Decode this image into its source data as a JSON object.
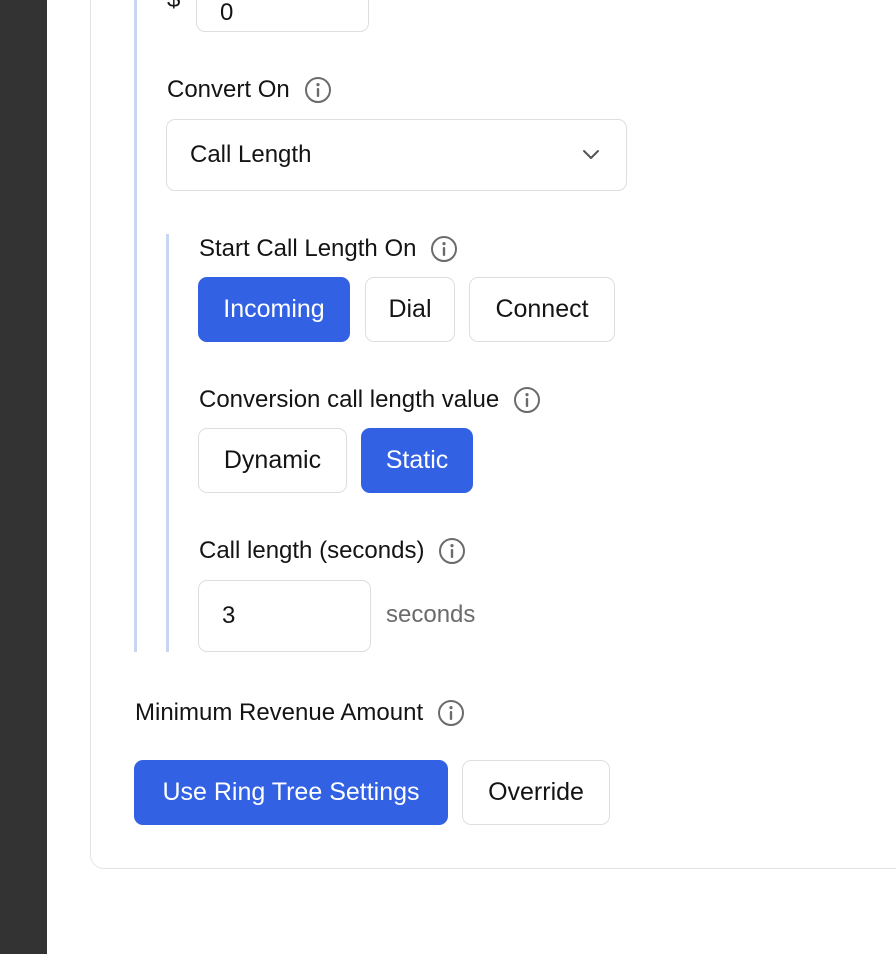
{
  "payout": {
    "currency_symbol": "$",
    "value": "0"
  },
  "convert_on": {
    "label": "Convert On",
    "selected": "Call Length"
  },
  "start_call_length_on": {
    "label": "Start Call Length On",
    "options": [
      "Incoming",
      "Dial",
      "Connect"
    ],
    "selected": "Incoming"
  },
  "conversion_value": {
    "label": "Conversion call length value",
    "options": [
      "Dynamic",
      "Static"
    ],
    "selected": "Static"
  },
  "call_length": {
    "label": "Call length (seconds)",
    "value": "3",
    "suffix": "seconds"
  },
  "min_revenue": {
    "label": "Minimum Revenue Amount",
    "options": [
      "Use Ring Tree Settings",
      "Override"
    ],
    "selected": "Use Ring Tree Settings"
  },
  "icons": {
    "info": "info-circle-icon",
    "dropdown": "chevron-down-icon"
  },
  "colors": {
    "accent": "#3262e3",
    "rail": "#333333",
    "section_bar": "#c8d6f2",
    "border": "#dedede"
  }
}
